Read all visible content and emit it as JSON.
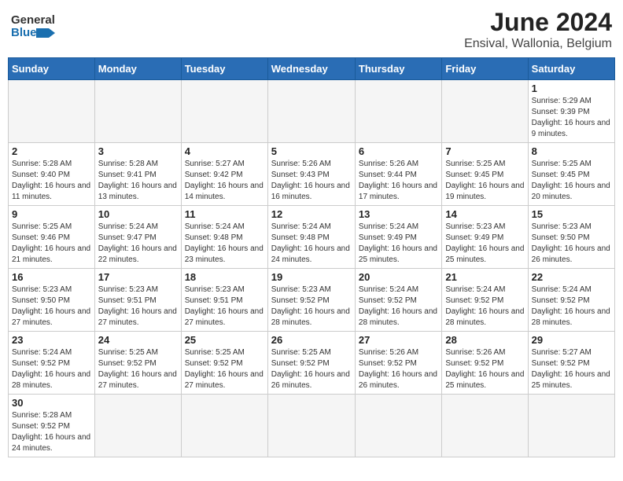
{
  "header": {
    "logo_general": "General",
    "logo_blue": "Blue",
    "month_year": "June 2024",
    "location": "Ensival, Wallonia, Belgium"
  },
  "days_of_week": [
    "Sunday",
    "Monday",
    "Tuesday",
    "Wednesday",
    "Thursday",
    "Friday",
    "Saturday"
  ],
  "weeks": [
    [
      {
        "day": "",
        "info": ""
      },
      {
        "day": "",
        "info": ""
      },
      {
        "day": "",
        "info": ""
      },
      {
        "day": "",
        "info": ""
      },
      {
        "day": "",
        "info": ""
      },
      {
        "day": "",
        "info": ""
      },
      {
        "day": "1",
        "info": "Sunrise: 5:29 AM\nSunset: 9:39 PM\nDaylight: 16 hours and 9 minutes."
      }
    ],
    [
      {
        "day": "2",
        "info": "Sunrise: 5:28 AM\nSunset: 9:40 PM\nDaylight: 16 hours and 11 minutes."
      },
      {
        "day": "3",
        "info": "Sunrise: 5:28 AM\nSunset: 9:41 PM\nDaylight: 16 hours and 13 minutes."
      },
      {
        "day": "4",
        "info": "Sunrise: 5:27 AM\nSunset: 9:42 PM\nDaylight: 16 hours and 14 minutes."
      },
      {
        "day": "5",
        "info": "Sunrise: 5:26 AM\nSunset: 9:43 PM\nDaylight: 16 hours and 16 minutes."
      },
      {
        "day": "6",
        "info": "Sunrise: 5:26 AM\nSunset: 9:44 PM\nDaylight: 16 hours and 17 minutes."
      },
      {
        "day": "7",
        "info": "Sunrise: 5:25 AM\nSunset: 9:45 PM\nDaylight: 16 hours and 19 minutes."
      },
      {
        "day": "8",
        "info": "Sunrise: 5:25 AM\nSunset: 9:45 PM\nDaylight: 16 hours and 20 minutes."
      }
    ],
    [
      {
        "day": "9",
        "info": "Sunrise: 5:25 AM\nSunset: 9:46 PM\nDaylight: 16 hours and 21 minutes."
      },
      {
        "day": "10",
        "info": "Sunrise: 5:24 AM\nSunset: 9:47 PM\nDaylight: 16 hours and 22 minutes."
      },
      {
        "day": "11",
        "info": "Sunrise: 5:24 AM\nSunset: 9:48 PM\nDaylight: 16 hours and 23 minutes."
      },
      {
        "day": "12",
        "info": "Sunrise: 5:24 AM\nSunset: 9:48 PM\nDaylight: 16 hours and 24 minutes."
      },
      {
        "day": "13",
        "info": "Sunrise: 5:24 AM\nSunset: 9:49 PM\nDaylight: 16 hours and 25 minutes."
      },
      {
        "day": "14",
        "info": "Sunrise: 5:23 AM\nSunset: 9:49 PM\nDaylight: 16 hours and 25 minutes."
      },
      {
        "day": "15",
        "info": "Sunrise: 5:23 AM\nSunset: 9:50 PM\nDaylight: 16 hours and 26 minutes."
      }
    ],
    [
      {
        "day": "16",
        "info": "Sunrise: 5:23 AM\nSunset: 9:50 PM\nDaylight: 16 hours and 27 minutes."
      },
      {
        "day": "17",
        "info": "Sunrise: 5:23 AM\nSunset: 9:51 PM\nDaylight: 16 hours and 27 minutes."
      },
      {
        "day": "18",
        "info": "Sunrise: 5:23 AM\nSunset: 9:51 PM\nDaylight: 16 hours and 27 minutes."
      },
      {
        "day": "19",
        "info": "Sunrise: 5:23 AM\nSunset: 9:52 PM\nDaylight: 16 hours and 28 minutes."
      },
      {
        "day": "20",
        "info": "Sunrise: 5:24 AM\nSunset: 9:52 PM\nDaylight: 16 hours and 28 minutes."
      },
      {
        "day": "21",
        "info": "Sunrise: 5:24 AM\nSunset: 9:52 PM\nDaylight: 16 hours and 28 minutes."
      },
      {
        "day": "22",
        "info": "Sunrise: 5:24 AM\nSunset: 9:52 PM\nDaylight: 16 hours and 28 minutes."
      }
    ],
    [
      {
        "day": "23",
        "info": "Sunrise: 5:24 AM\nSunset: 9:52 PM\nDaylight: 16 hours and 28 minutes."
      },
      {
        "day": "24",
        "info": "Sunrise: 5:25 AM\nSunset: 9:52 PM\nDaylight: 16 hours and 27 minutes."
      },
      {
        "day": "25",
        "info": "Sunrise: 5:25 AM\nSunset: 9:52 PM\nDaylight: 16 hours and 27 minutes."
      },
      {
        "day": "26",
        "info": "Sunrise: 5:25 AM\nSunset: 9:52 PM\nDaylight: 16 hours and 26 minutes."
      },
      {
        "day": "27",
        "info": "Sunrise: 5:26 AM\nSunset: 9:52 PM\nDaylight: 16 hours and 26 minutes."
      },
      {
        "day": "28",
        "info": "Sunrise: 5:26 AM\nSunset: 9:52 PM\nDaylight: 16 hours and 25 minutes."
      },
      {
        "day": "29",
        "info": "Sunrise: 5:27 AM\nSunset: 9:52 PM\nDaylight: 16 hours and 25 minutes."
      }
    ],
    [
      {
        "day": "30",
        "info": "Sunrise: 5:28 AM\nSunset: 9:52 PM\nDaylight: 16 hours and 24 minutes."
      },
      {
        "day": "",
        "info": ""
      },
      {
        "day": "",
        "info": ""
      },
      {
        "day": "",
        "info": ""
      },
      {
        "day": "",
        "info": ""
      },
      {
        "day": "",
        "info": ""
      },
      {
        "day": "",
        "info": ""
      }
    ]
  ],
  "colors": {
    "header_bg": "#2a6db5",
    "logo_blue": "#1a6faf"
  }
}
